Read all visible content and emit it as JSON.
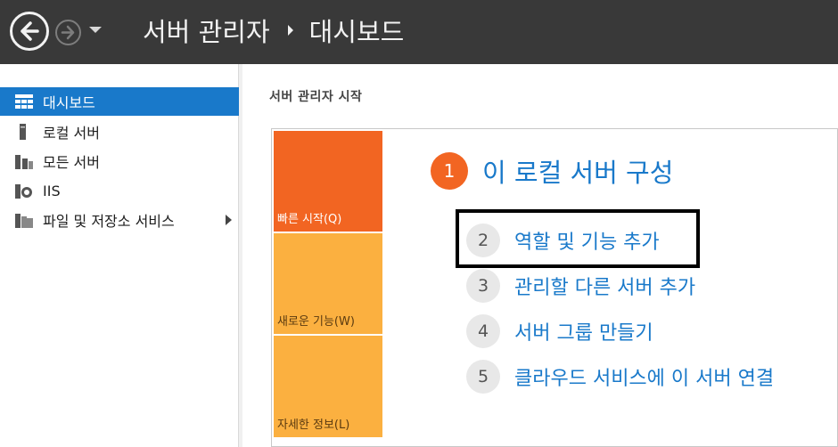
{
  "titlebar": {
    "app": "서버 관리자",
    "page": "대시보드",
    "back_icon": "back-arrow-icon",
    "forward_icon": "forward-arrow-icon"
  },
  "sidebar": {
    "items": [
      {
        "label": "대시보드",
        "icon": "dashboard-icon",
        "active": true
      },
      {
        "label": "로컬 서버",
        "icon": "server-icon"
      },
      {
        "label": "모든 서버",
        "icon": "servers-icon"
      },
      {
        "label": "IIS",
        "icon": "iis-icon"
      },
      {
        "label": "파일 및 저장소 서비스",
        "icon": "file-storage-icon",
        "expandable": true
      }
    ]
  },
  "main": {
    "section_title": "서버 관리자 시작",
    "tiles": [
      {
        "label": "빠른 시작(Q)"
      },
      {
        "label": "새로운 기능(W)"
      },
      {
        "label": "자세한 정보(L)"
      }
    ],
    "steps": [
      {
        "num": "1",
        "label": "이 로컬 서버 구성"
      },
      {
        "num": "2",
        "label": "역할 및 기능 추가"
      },
      {
        "num": "3",
        "label": "관리할 다른 서버 추가"
      },
      {
        "num": "4",
        "label": "서버 그룹 만들기"
      },
      {
        "num": "5",
        "label": "클라우드 서비스에 이 서버 연결"
      }
    ]
  },
  "colors": {
    "titlebar_bg": "#393939",
    "accent_blue": "#1979ca",
    "tile_orange": "#f26522",
    "tile_yellow": "#fbb040"
  }
}
